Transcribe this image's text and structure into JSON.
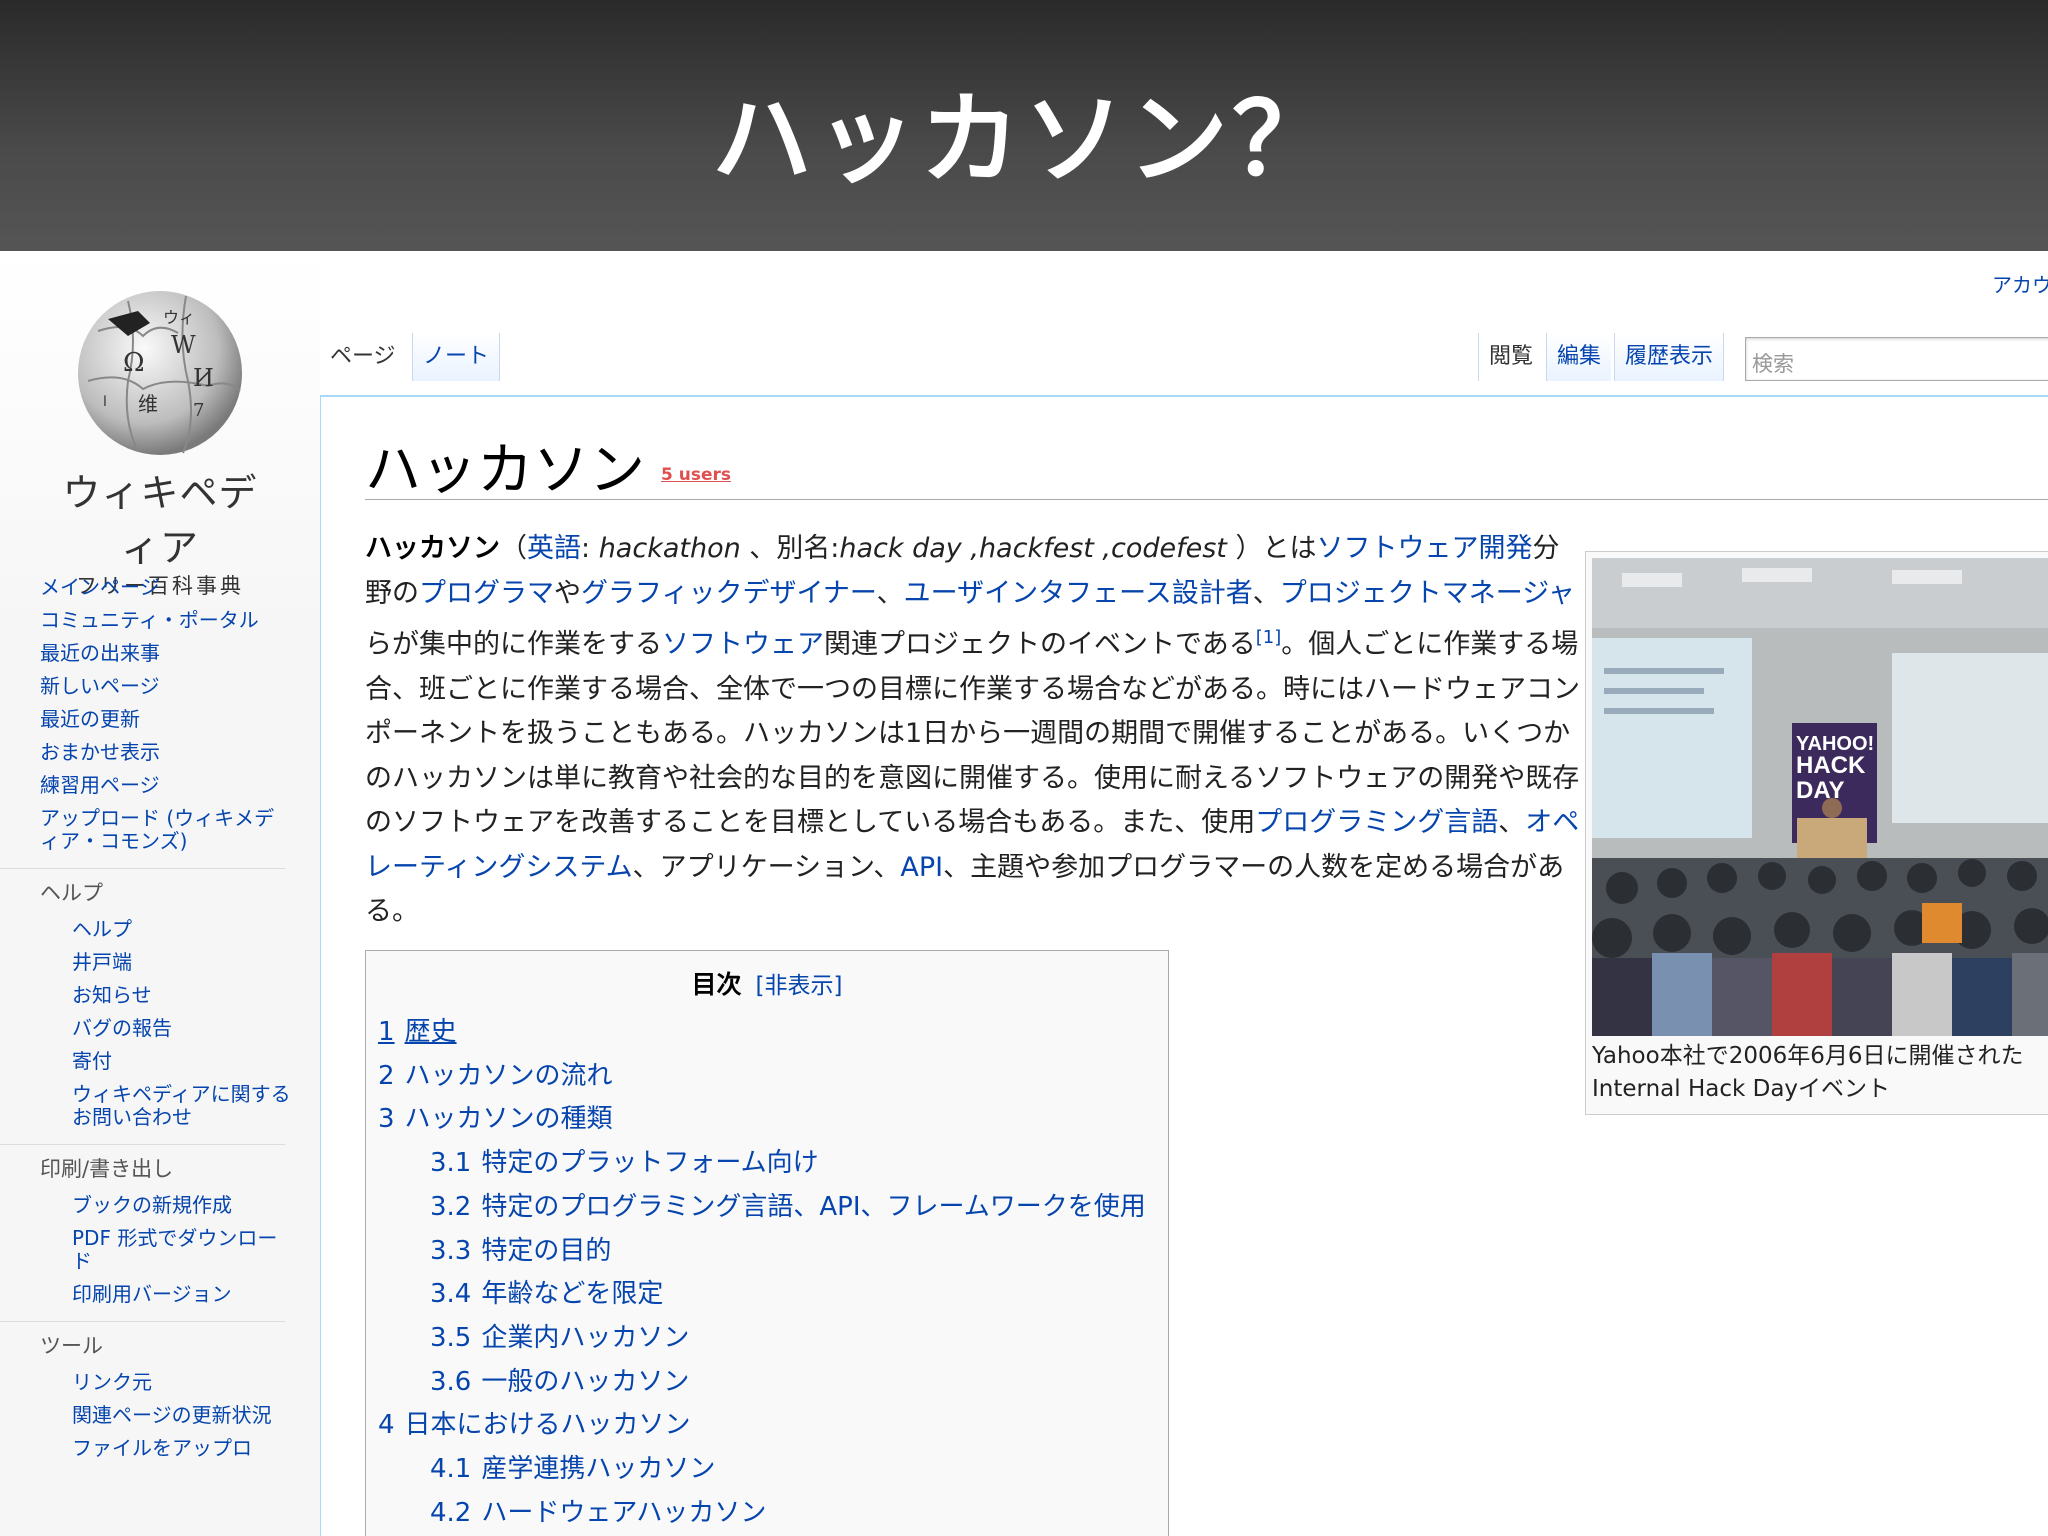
{
  "slide": {
    "title": "ハッカソン？"
  },
  "sidebar": {
    "logo_name": "ウィキペディア",
    "logo_tagline": "フリー百科事典",
    "portal": [
      "メインページ",
      "コミュニティ・ポータル",
      "最近の出来事",
      "新しいページ",
      "最近の更新",
      "おまかせ表示",
      "練習用ページ",
      "アップロード (ウィキメディア・コモンズ)"
    ],
    "help_heading": "ヘルプ",
    "help": [
      "ヘルプ",
      "井戸端",
      "お知らせ",
      "バグの報告",
      "寄付",
      "ウィキペディアに関するお問い合わせ"
    ],
    "print_heading": "印刷/書き出し",
    "print": [
      "ブックの新規作成",
      "PDF 形式でダウンロード",
      "印刷用バージョン"
    ],
    "tools_heading": "ツール",
    "tools": [
      "リンク元",
      "関連ページの更新状況",
      "ファイルをアップロ"
    ]
  },
  "tabs": {
    "page": "ページ",
    "note": "ノート",
    "read": "閲覧",
    "edit": "編集",
    "history": "履歴表示"
  },
  "search": {
    "placeholder": "検索"
  },
  "account": {
    "label": "アカウ"
  },
  "article": {
    "title": "ハッカソン",
    "users_badge": "5 users",
    "lead": {
      "t1": "ハッカソン",
      "t2": "（",
      "l_english": "英語",
      "t3": ": ",
      "i_hackathon": "hackathon",
      "t4": " 、別名:",
      "i_aliases": "hack day ,hackfest ,codefest",
      "t5": " ）とは",
      "l_software_dev": "ソフトウェア開発",
      "t6": "分野の",
      "l_programmer": "プログラマ",
      "t7": "や",
      "l_graphic": "グラフィックデザイナー",
      "t8": "、",
      "l_ui_designer": "ユーザインタフェース設計者",
      "t9": "、",
      "l_pm": "プロジェクトマネージャ",
      "t10": "らが集中的に作業をする",
      "l_software": "ソフトウェア",
      "t11": "関連プロジェクトのイベントである",
      "ref": "[1]",
      "t12": "。個人ごとに作業する場合、班ごとに作業する場合、全体で一つの目標に作業する場合などがある。時にはハードウェアコンポーネントを扱うこともある。ハッカソンは1日から一週間の期間で開催することがある。いくつかのハッカソンは単に教育や社会的な目的を意図に開催する。使用に耐えるソフトウェアの開発や既存のソフトウェアを改善することを目標としている場合もある。また、使用",
      "l_prog_lang": "プログラミング言語",
      "t13": "、",
      "l_os": "オペレーティングシステム",
      "t14": "、アプリケーション、",
      "l_api": "API",
      "t15": "、主題や参加プログラマーの人数を定める場合がある。"
    },
    "infobox": {
      "banner_lines": [
        "YAHOO!",
        "HACK",
        "DAY"
      ],
      "caption_line1": "Yahoo本社で2006年6月6日に開催された",
      "caption_line2": "Internal Hack Dayイベント"
    },
    "toc": {
      "title": "目次",
      "toggle": "[非表示]",
      "items": [
        {
          "num": "1",
          "label": "歴史"
        },
        {
          "num": "2",
          "label": "ハッカソンの流れ"
        },
        {
          "num": "3",
          "label": "ハッカソンの種類"
        },
        {
          "num": "3.1",
          "label": "特定のプラットフォーム向け"
        },
        {
          "num": "3.2",
          "label": "特定のプログラミング言語、API、フレームワークを使用"
        },
        {
          "num": "3.3",
          "label": "特定の目的"
        },
        {
          "num": "3.4",
          "label": "年齢などを限定"
        },
        {
          "num": "3.5",
          "label": "企業内ハッカソン"
        },
        {
          "num": "3.6",
          "label": "一般のハッカソン"
        },
        {
          "num": "4",
          "label": "日本におけるハッカソン"
        },
        {
          "num": "4.1",
          "label": "産学連携ハッカソン"
        },
        {
          "num": "4.2",
          "label": "ハードウェアハッカソン"
        }
      ]
    }
  }
}
